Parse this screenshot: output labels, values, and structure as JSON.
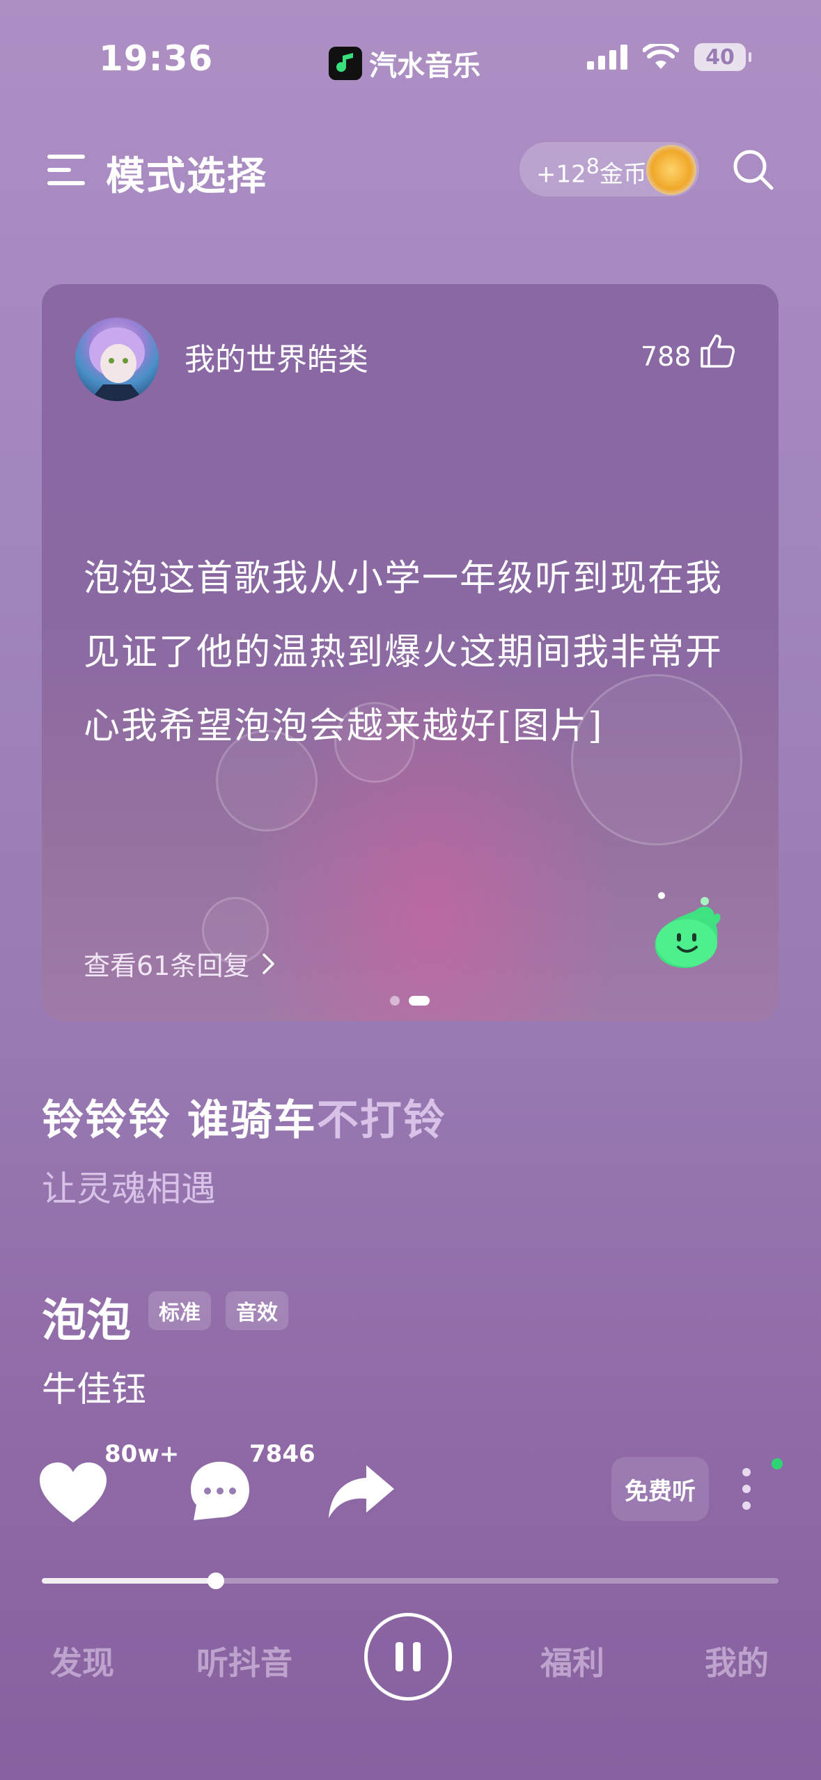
{
  "status_bar": {
    "time": "19:36",
    "app_name": "汽水音乐",
    "battery": "40"
  },
  "header": {
    "title": "模式选择",
    "coins_prefix": "+12",
    "coins_superscript": "8",
    "coins_suffix": "金币"
  },
  "comment_card": {
    "username": "我的世界皓类",
    "like_count": "788",
    "text": "泡泡这首歌我从小学一年级听到现在我见证了他的温热到爆火这期间我非常开心我希望泡泡会越来越好[图片]",
    "replies_label": "查看61条回复"
  },
  "lyrics": {
    "sung": "铃铃铃 谁骑车",
    "upcoming": "不打铃",
    "next_line": "让灵魂相遇"
  },
  "song": {
    "title": "泡泡",
    "tags": [
      "标准",
      "音效"
    ],
    "artist": "牛佳钰"
  },
  "actions": {
    "like_count": "80w+",
    "comment_count": "7846",
    "free_listen": "免费听"
  },
  "playback": {
    "progress_fraction": 0.236
  },
  "tab_bar": {
    "discover": "发现",
    "douyin": "听抖音",
    "welfare": "福利",
    "mine": "我的"
  },
  "colors": {
    "background": "#9a7cb4",
    "card": "#8a68a3",
    "accent_dim": "#d8c2e8",
    "status_dot": "#2ed573"
  },
  "icons": [
    "menu-icon",
    "search-icon",
    "coin-icon",
    "like-icon",
    "chevron-right-icon",
    "heart-icon",
    "comment-icon",
    "share-icon",
    "more-icon",
    "pause-icon"
  ]
}
